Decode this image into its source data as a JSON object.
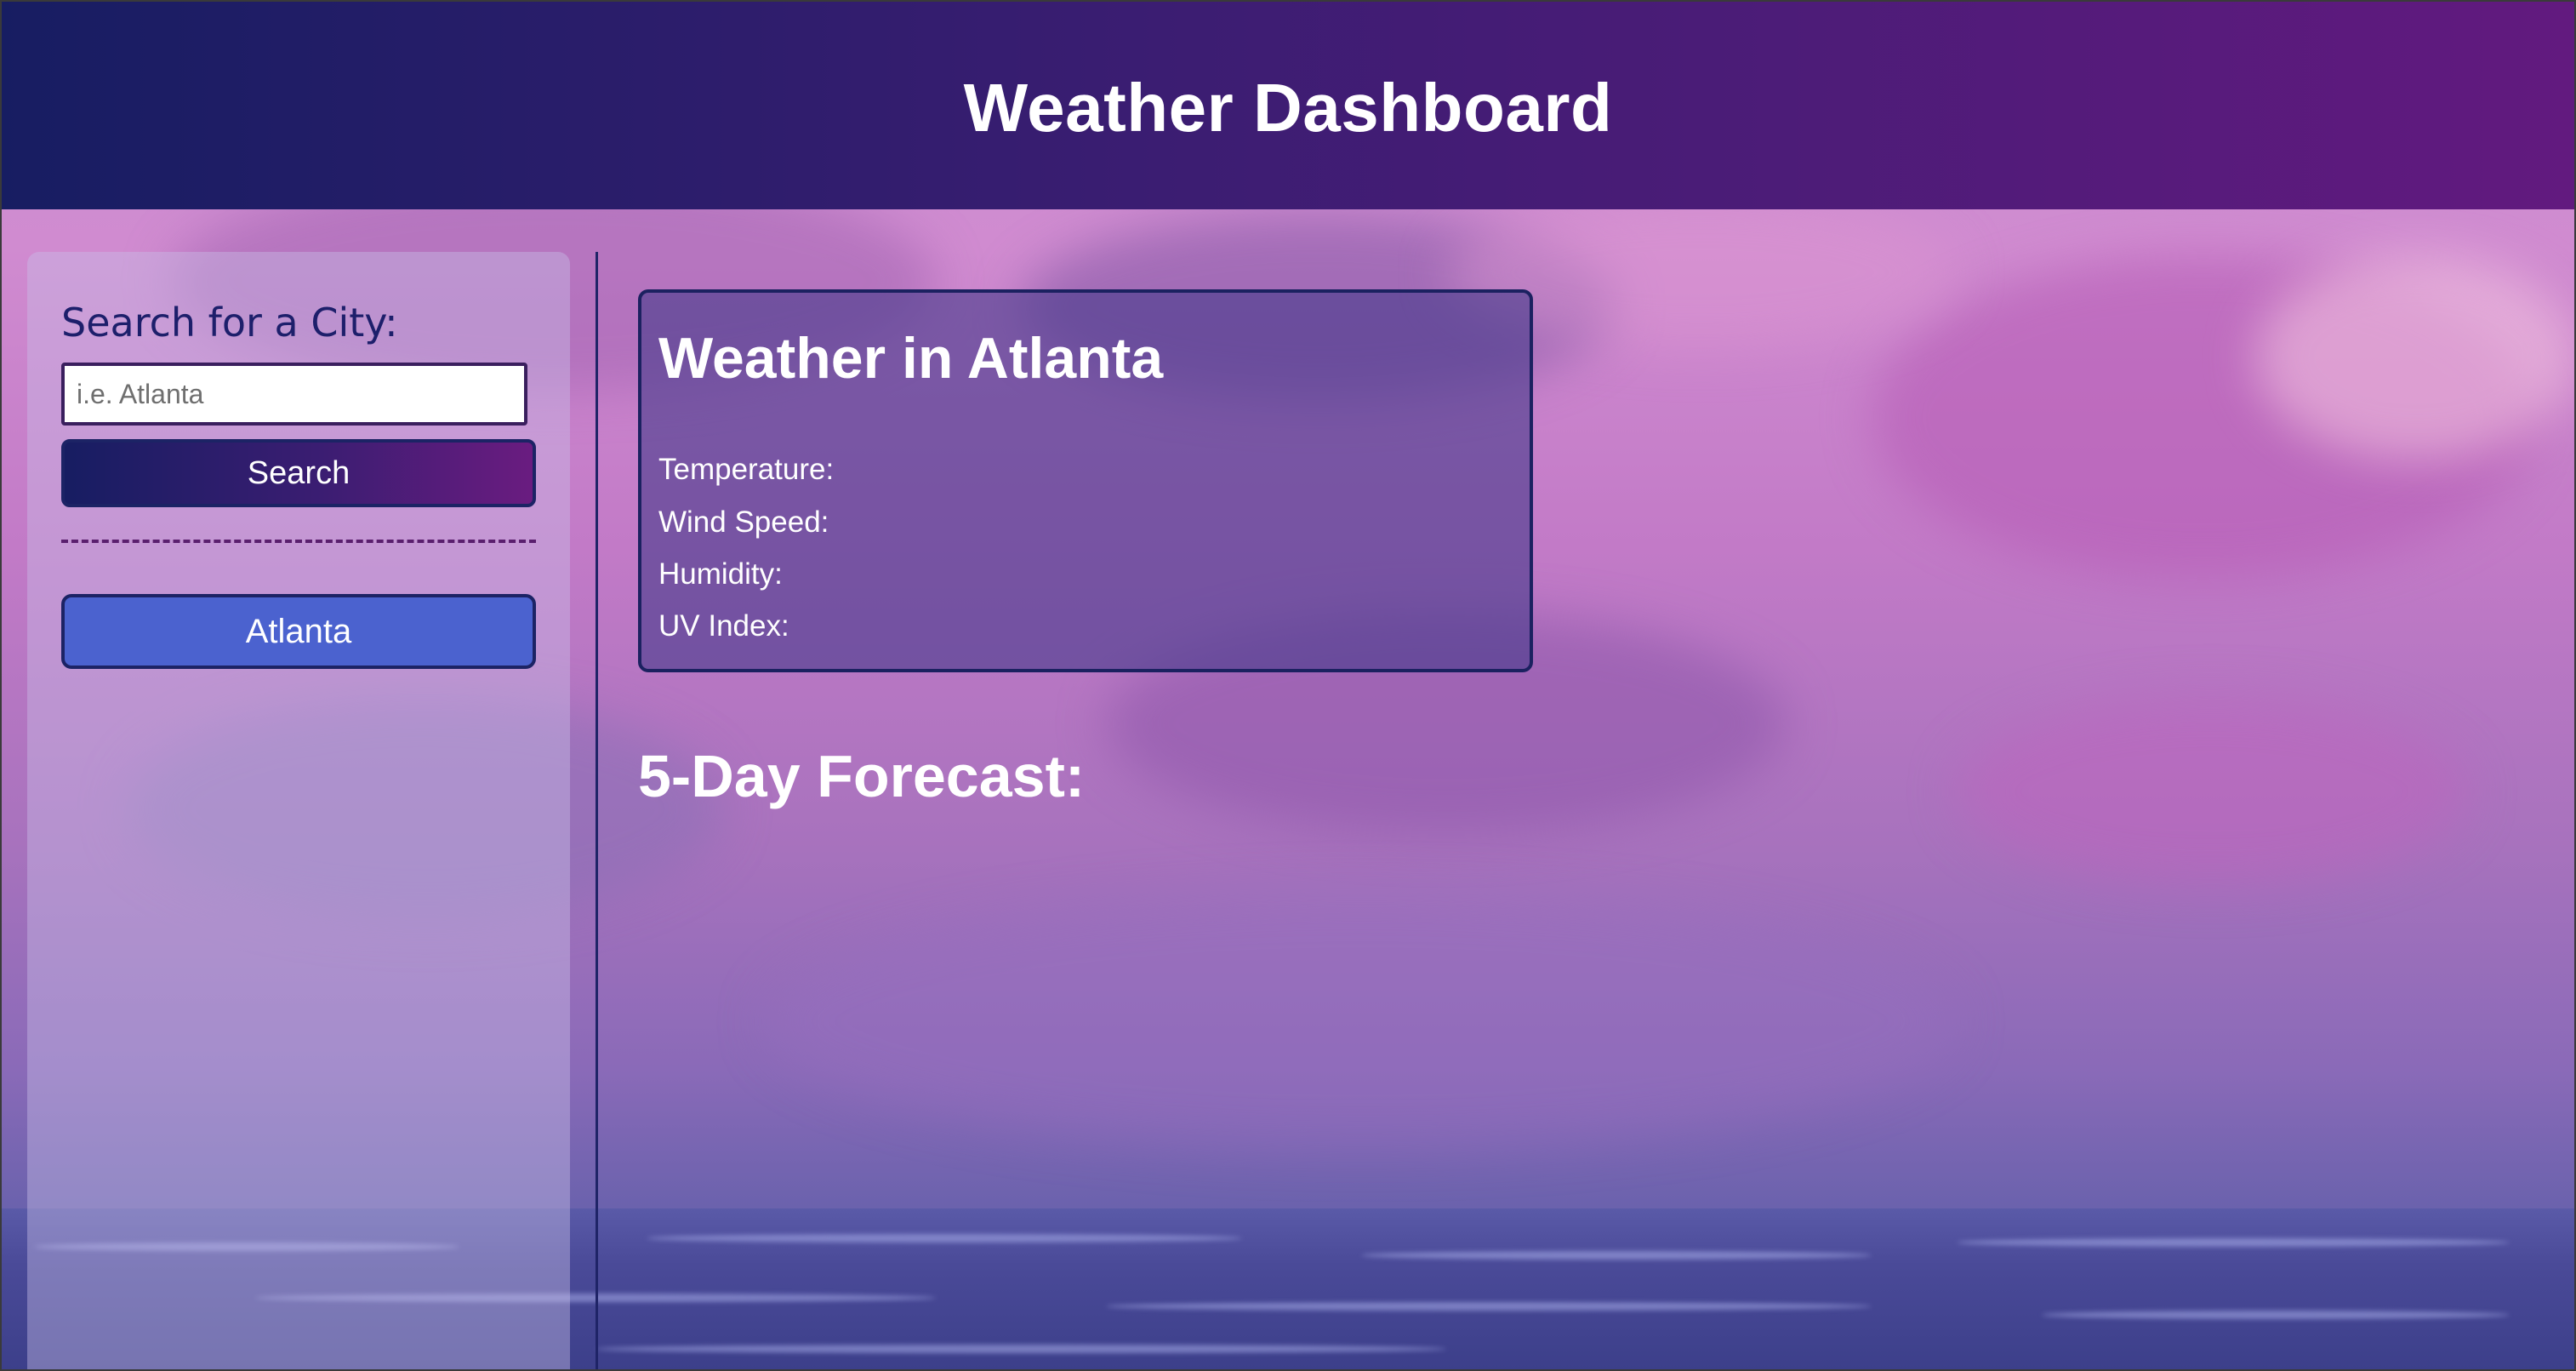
{
  "header": {
    "title": "Weather Dashboard"
  },
  "sidebar": {
    "search_label": "Search for a City:",
    "search_placeholder": "i.e. Atlanta",
    "search_button_label": "Search",
    "history": [
      {
        "label": "Atlanta"
      }
    ]
  },
  "current_weather": {
    "title": "Weather in Atlanta",
    "temperature_label": "Temperature:",
    "wind_speed_label": "Wind Speed:",
    "humidity_label": "Humidity:",
    "uv_index_label": "UV Index:"
  },
  "forecast": {
    "title": "5-Day Forecast:"
  },
  "colors": {
    "header_gradient_start": "#171d62",
    "header_gradient_end": "#621a7f",
    "history_button": "#4b62cf",
    "label_text": "#1d1f6b"
  }
}
